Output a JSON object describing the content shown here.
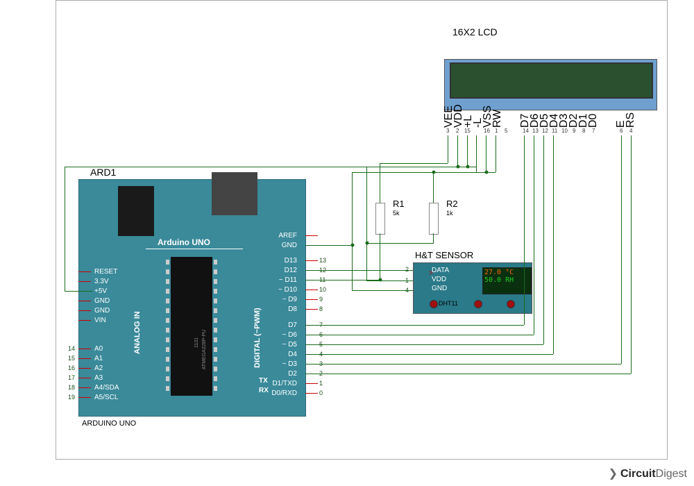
{
  "title_lcd": "16X2 LCD",
  "lcd_pins": [
    "VEE",
    "VDD",
    "+L",
    "-L",
    "VSS",
    "RW",
    "D7",
    "D6",
    "D5",
    "D4",
    "D3",
    "D2",
    "D1",
    "D0",
    "E",
    "RS"
  ],
  "lcd_pin_nums": [
    "3",
    "2",
    "15",
    "",
    "16",
    "1",
    "5",
    "14",
    "13",
    "12",
    "11",
    "10",
    "9",
    "8",
    "7",
    "",
    "6",
    "4"
  ],
  "ard_label": "ARD1",
  "ard_name": "Arduino UNO",
  "ard_footer": "ARDUINO UNO",
  "chip_text": "ATMEGA328P-PU",
  "chip_text2": "1131",
  "left_pins": [
    "RESET",
    "3.3V",
    "+5V",
    "GND",
    "GND",
    "VIN"
  ],
  "analog_pins": [
    "A0",
    "A1",
    "A2",
    "A3",
    "A4/SDA",
    "A5/SCL"
  ],
  "analog_nums": [
    "14",
    "15",
    "16",
    "17",
    "18",
    "19"
  ],
  "right_pins_top": [
    "AREF",
    "GND"
  ],
  "right_pins_d13": [
    "D13",
    "D12",
    "~ D11",
    "~ D10",
    "~ D9",
    "D8"
  ],
  "right_nums_d13": [
    "13",
    "12",
    "11",
    "10",
    "9",
    "8"
  ],
  "right_pins_d7": [
    "D7",
    "~ D6",
    "~ D5",
    "D4",
    "~ D3",
    "D2",
    "D1/TXD",
    "D0/RXD"
  ],
  "right_nums_d7": [
    "7",
    "6",
    "5",
    "4",
    "3",
    "2",
    "1",
    "0"
  ],
  "analog_in": "ANALOG IN",
  "digital_pwm": "DIGITAL (~PWM)",
  "tx": "TX",
  "rx": "RX",
  "r1_label": "R1",
  "r1_val": "5k",
  "r2_label": "R2",
  "r2_val": "1k",
  "sensor_label": "H&T SENSOR",
  "sensor_pins": [
    "DATA",
    "VDD",
    "GND"
  ],
  "sensor_pin_nums": [
    "2",
    "1",
    "4"
  ],
  "sensor_name": "DHT11",
  "sensor_temp": "27.0 °C",
  "sensor_hum": "50.0 RH",
  "watermark1": "Circuit",
  "watermark2": "Digest"
}
